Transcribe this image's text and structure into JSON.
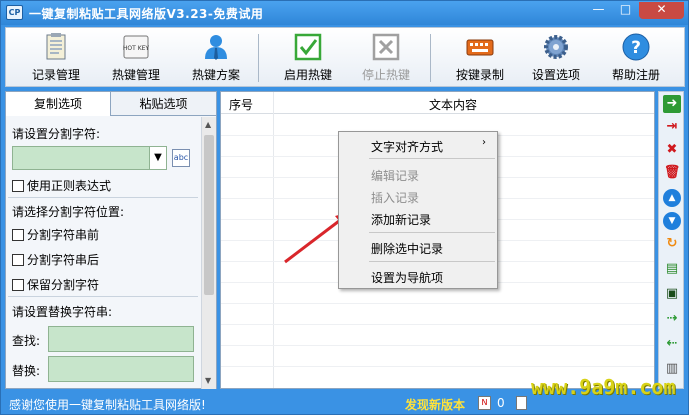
{
  "window": {
    "title": "一键复制粘贴工具网络版V3.23-免费试用",
    "icon_text": "CP",
    "min_label": "—",
    "max_label": "□",
    "close_label": "✕"
  },
  "toolbar": {
    "items": [
      {
        "label": "记录管理",
        "icon": "notepad-icon"
      },
      {
        "label": "热键管理",
        "icon": "hotkey-icon",
        "icon_text": "HOT KEY"
      },
      {
        "label": "热键方案",
        "icon": "user-icon"
      },
      {
        "label": "启用热键",
        "icon": "checkmark-icon"
      },
      {
        "label": "停止热键",
        "icon": "stop-icon",
        "disabled": true
      },
      {
        "label": "按键录制",
        "icon": "keyboard-icon"
      },
      {
        "label": "设置选项",
        "icon": "gear-icon"
      },
      {
        "label": "帮助注册",
        "icon": "help-icon",
        "icon_text": "?"
      }
    ]
  },
  "left_panel": {
    "tabs": [
      "复制选项",
      "粘贴选项"
    ],
    "active_tab": "复制选项",
    "separator_label": "请设置分割字符:",
    "use_regex_label": "使用正则表达式",
    "position_label": "请选择分割字符位置:",
    "position_options": [
      "分割字符串前",
      "分割字符串后",
      "保留分割字符"
    ],
    "replace_label": "请设置替换字符串:",
    "find_label": "查找:",
    "replace_with_label": "替换:",
    "abc_icon_text": "abc"
  },
  "list": {
    "columns": [
      "序号",
      "文本内容"
    ]
  },
  "context_menu": {
    "items": [
      {
        "label": "文字对齐方式",
        "disabled": false,
        "submenu": true
      },
      {
        "label": "编辑记录",
        "disabled": true
      },
      {
        "label": "插入记录",
        "disabled": true
      },
      {
        "label": "添加新记录",
        "disabled": false
      },
      {
        "label": "删除选中记录",
        "disabled": false
      },
      {
        "label": "设置为导航项",
        "disabled": false
      }
    ],
    "submenu_arrow": "›"
  },
  "status": {
    "message": "感谢您使用一键复制粘贴工具网络版!",
    "new_version": "发现新版本",
    "count": "0",
    "icon_text": "N"
  },
  "watermark": "www.9a9m.com",
  "colors": {
    "title_bar": "#3a92e4",
    "field_green": "#c7e5cb",
    "new_version": "#ffe23a",
    "arrow_red": "#d9262b"
  }
}
